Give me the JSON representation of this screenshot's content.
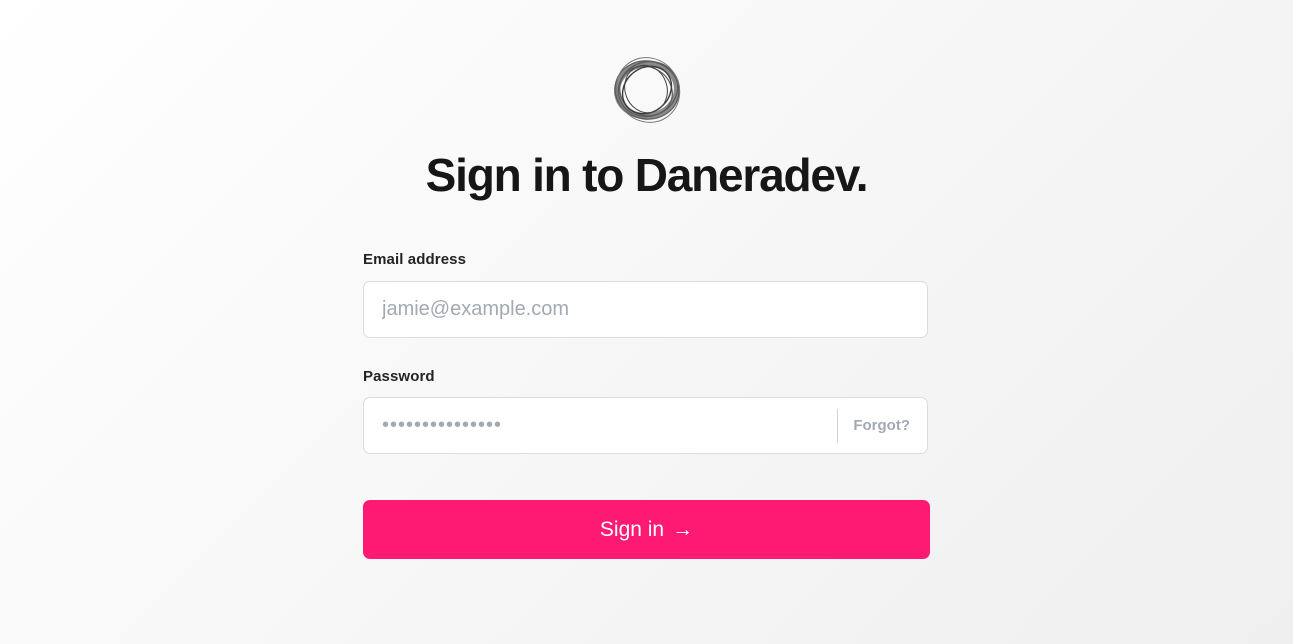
{
  "header": {
    "logo_icon": "ring-logo-icon",
    "title": "Sign in to Daneradev."
  },
  "form": {
    "email": {
      "label": "Email address",
      "value": "",
      "placeholder": "jamie@example.com"
    },
    "password": {
      "label": "Password",
      "value": "",
      "placeholder": "•••••••••••••••",
      "forgot_label": "Forgot?"
    },
    "submit": {
      "label": "Sign in",
      "icon": "arrow-right-icon",
      "arrow_glyph": "→"
    }
  },
  "colors": {
    "accent": "#fe1a72",
    "text": "#161616",
    "muted": "#a3a9b3",
    "border": "#dcdcdf"
  }
}
